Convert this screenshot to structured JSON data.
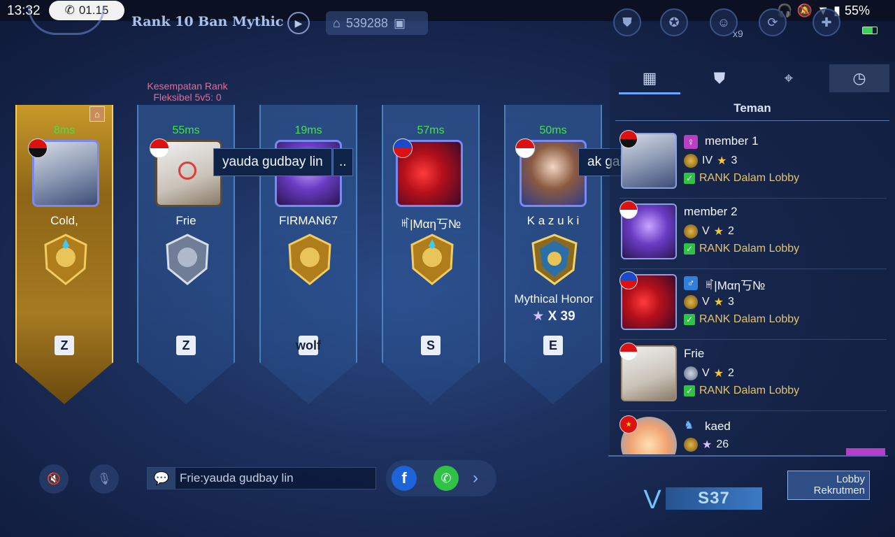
{
  "status_bar": {
    "time": "13:32",
    "call_timer": "01.15",
    "battery": "55%",
    "icons": [
      "headphones-icon",
      "mute-icon",
      "bluetooth-icon",
      "wifi-icon",
      "nfc-icon",
      "vibrate-icon",
      "battery-icon"
    ]
  },
  "header": {
    "mode_title": "Rank 10 Ban Mythic",
    "room_id": "539288",
    "friend_count": "x9",
    "icons": [
      "back-icon",
      "play-icon",
      "home-icon",
      "gallery-icon",
      "shield-icon",
      "squad-icon",
      "friends-icon",
      "network-icon",
      "flag-icon"
    ]
  },
  "rank_chance": {
    "line1": "Kesempatan Rank",
    "line2": "Fleksibel 5v5: 0"
  },
  "slots": [
    {
      "ping": "8ms",
      "name": "Cold,",
      "flag": "angola",
      "role_icon": "Z",
      "highlight": true
    },
    {
      "ping": "55ms",
      "name": "Frie",
      "flag": "indonesia",
      "role_icon": "Z",
      "bubble": "yauda gudbay lin"
    },
    {
      "ping": "19ms",
      "name": "FIRMAN67",
      "flag": "indonesia",
      "role_icon": "wolf",
      "bubble_suffix": ".."
    },
    {
      "ping": "57ms",
      "name": "ꎭ|Mαη丂№",
      "flag": "philippines",
      "role_icon": "S"
    },
    {
      "ping": "50ms",
      "name": "K a z u k i",
      "flag": "indonesia",
      "role_icon": "E",
      "bubble": "ak gabisa",
      "rank_label": "Mythical Honor",
      "stars": "X 39"
    }
  ],
  "chat": {
    "last_message": "Frie:yauda gudbay lin"
  },
  "right_panel": {
    "tabs": [
      "grid-icon",
      "shield-icon",
      "location-icon",
      "history-icon"
    ],
    "title": "Teman",
    "friends": [
      {
        "name": "member 1",
        "gender": "♀",
        "rank": "IV",
        "stars": "3",
        "status": "RANK Dalam Lobby",
        "flag": "angola"
      },
      {
        "name": "member 2",
        "gender": "",
        "rank": "V",
        "stars": "2",
        "status": "RANK Dalam Lobby",
        "flag": "indonesia"
      },
      {
        "name": "ꎭ|Mαη丂№",
        "gender": "♂",
        "rank": "V",
        "stars": "3",
        "status": "RANK Dalam Lobby",
        "flag": "philippines"
      },
      {
        "name": "Frie",
        "gender": "",
        "rank": "V",
        "stars": "2",
        "status": "RANK Dalam Lobby",
        "flag": "indonesia"
      },
      {
        "name": "kaed",
        "gender": "",
        "rank": "",
        "stars": "26",
        "status": "",
        "flag": "china"
      }
    ]
  },
  "season": {
    "label": "S37"
  },
  "recruit": {
    "line1": "Lobby",
    "line2": "Rekrutmen"
  },
  "colors": {
    "ping_green": "#44e24a",
    "status_gold": "#e6c36b",
    "rank_chance_pink": "#e36c9a",
    "accent_blue": "#6aa6ff"
  }
}
